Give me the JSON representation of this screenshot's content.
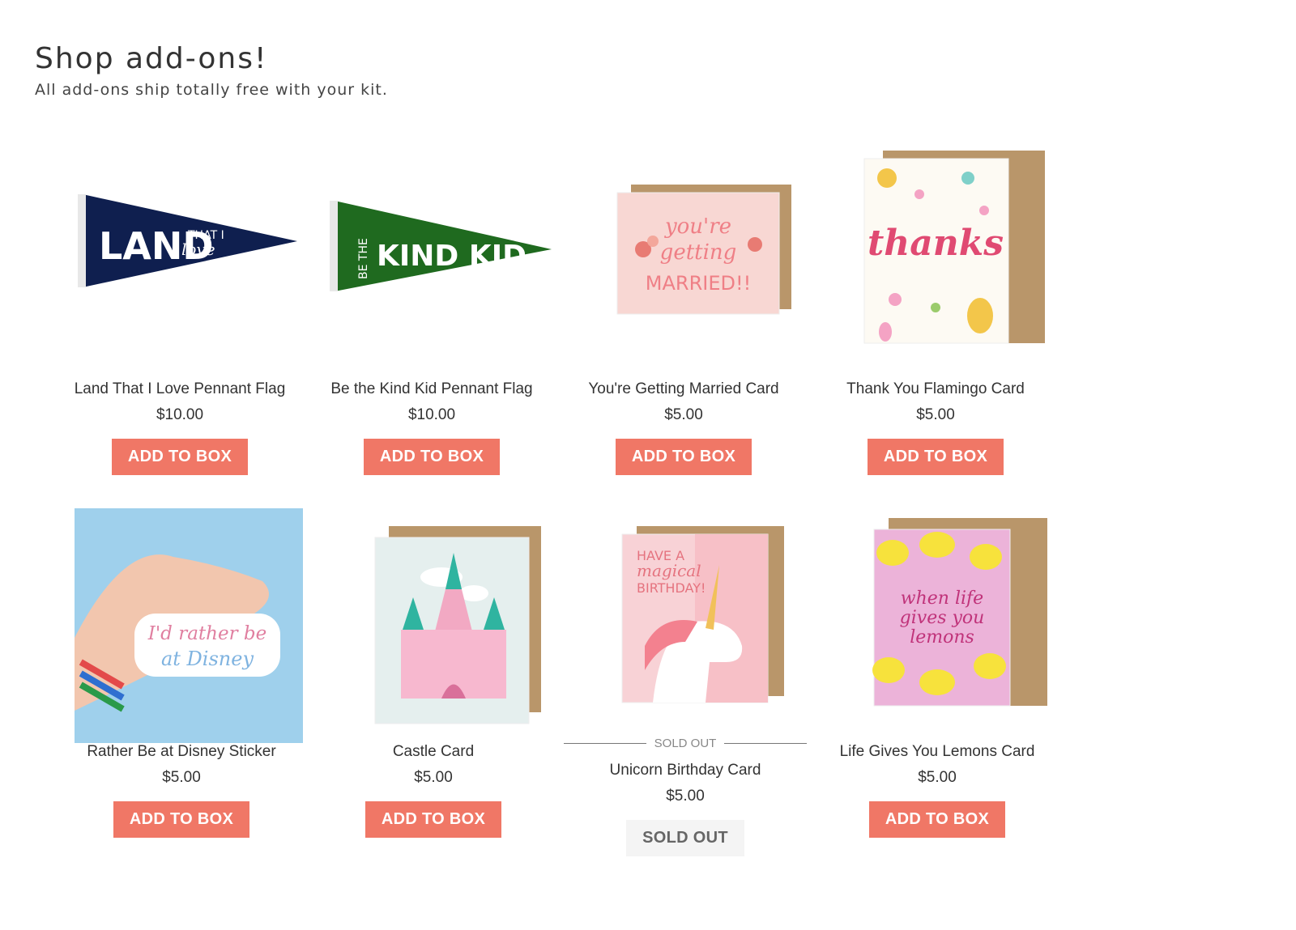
{
  "header": {
    "title": "Shop add-ons!",
    "subtitle": "All add-ons ship totally free with your kit."
  },
  "colors": {
    "accent": "#f07766",
    "sold_out_bg": "#f4f4f4"
  },
  "products": [
    {
      "name": "Land That I Love Pennant Flag",
      "price": "$10.00",
      "button": "ADD TO BOX",
      "art": {
        "line1": "LAND",
        "line2": "THAT I",
        "line3": "love"
      }
    },
    {
      "name": "Be the Kind Kid Pennant Flag",
      "price": "$10.00",
      "button": "ADD TO BOX",
      "art": {
        "line1": "BE THE",
        "line2": "KIND KID"
      }
    },
    {
      "name": "You're Getting Married Card",
      "price": "$5.00",
      "button": "ADD TO BOX",
      "art": {
        "line1": "you're",
        "line2": "getting",
        "line3": "MARRIED!!"
      }
    },
    {
      "name": "Thank You Flamingo Card",
      "price": "$5.00",
      "button": "ADD TO BOX",
      "art": {
        "line1": "thanks"
      }
    },
    {
      "name": "Rather Be at Disney Sticker",
      "price": "$5.00",
      "button": "ADD TO BOX",
      "art": {
        "line1": "I'd rather be",
        "line2": "at Disney"
      }
    },
    {
      "name": "Castle Card",
      "price": "$5.00",
      "button": "ADD TO BOX"
    },
    {
      "name": "Unicorn Birthday Card",
      "price": "$5.00",
      "button": "SOLD OUT",
      "sold_out_label": "SOLD OUT",
      "art": {
        "line1": "HAVE A",
        "line2": "magical",
        "line3": "BIRTHDAY!"
      }
    },
    {
      "name": "Life Gives You Lemons Card",
      "price": "$5.00",
      "button": "ADD TO BOX",
      "art": {
        "line1": "when life",
        "line2": "gives you",
        "line3": "lemons"
      }
    }
  ]
}
